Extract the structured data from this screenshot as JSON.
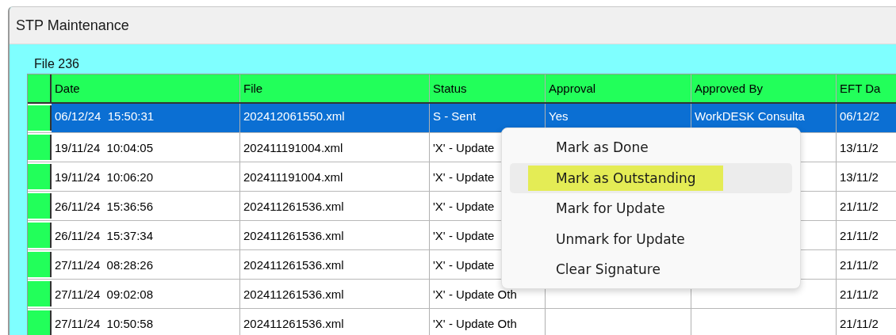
{
  "window": {
    "title": "STP Maintenance"
  },
  "file_label": "File 236",
  "table": {
    "columns": [
      "Date",
      "File",
      "Status",
      "Approval",
      "Approved By",
      "EFT Da"
    ],
    "rows": [
      {
        "selected": true,
        "cells": [
          "06/12/24  15:50:31",
          "202412061550.xml",
          "S - Sent",
          "Yes",
          "WorkDESK Consulta",
          "06/12/2"
        ]
      },
      {
        "selected": false,
        "cells": [
          "19/11/24  10:04:05",
          "202411191004.xml",
          "'X' - Update",
          "",
          "",
          "13/11/2"
        ]
      },
      {
        "selected": false,
        "cells": [
          "19/11/24  10:06:20",
          "202411191004.xml",
          "'X' - Update",
          "",
          "",
          "13/11/2"
        ]
      },
      {
        "selected": false,
        "cells": [
          "26/11/24  15:36:56",
          "202411261536.xml",
          "'X' - Update",
          "",
          "",
          "21/11/2"
        ]
      },
      {
        "selected": false,
        "cells": [
          "26/11/24  15:37:34",
          "202411261536.xml",
          "'X' - Update",
          "",
          "",
          "21/11/2"
        ]
      },
      {
        "selected": false,
        "cells": [
          "27/11/24  08:28:26",
          "202411261536.xml",
          "'X' - Update",
          "",
          "",
          "21/11/2"
        ]
      },
      {
        "selected": false,
        "cells": [
          "27/11/24  09:02:08",
          "202411261536.xml",
          "'X' - Update Oth",
          "",
          "",
          "21/11/2"
        ]
      },
      {
        "selected": false,
        "cells": [
          "27/11/24  10:50:58",
          "202411261536.xml",
          "'X' - Update Oth",
          "",
          "",
          "21/11/2"
        ]
      }
    ]
  },
  "context_menu": {
    "items": [
      {
        "label": "Mark as Done",
        "selected": false
      },
      {
        "label": "Mark as Outstanding",
        "selected": true
      },
      {
        "label": "Mark for Update",
        "selected": false
      },
      {
        "label": "Unmark for Update",
        "selected": false
      },
      {
        "label": "Clear Signature",
        "selected": false
      }
    ]
  }
}
